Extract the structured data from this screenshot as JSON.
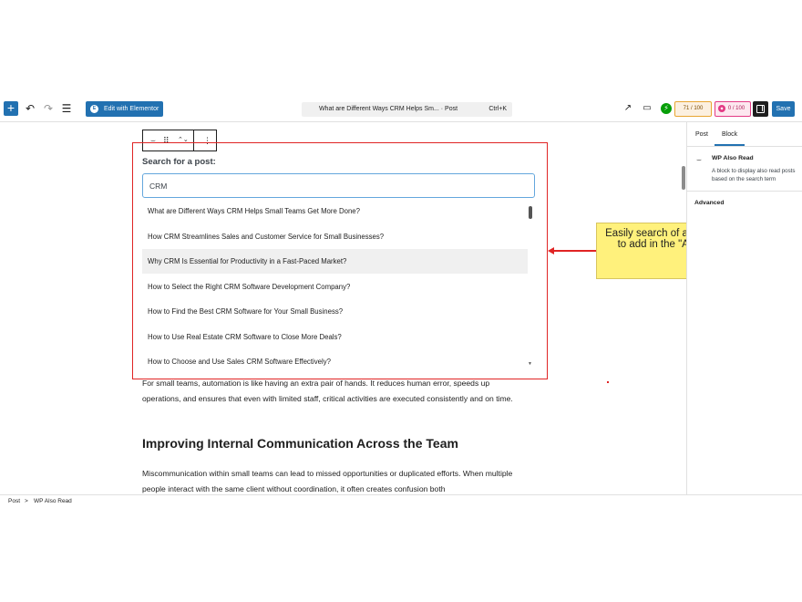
{
  "toolbar": {
    "add_icon": "plus-icon",
    "undo_icon": "undo-icon",
    "redo_icon": "redo-icon",
    "outline_icon": "list-view-icon",
    "edit_with_elementor": "Edit with Elementor",
    "command_title": "What are Different Ways CRM Helps Sm... · Post",
    "command_shortcut": "Ctrl+K",
    "score_seo": "71 / 100",
    "score_readability": "0 / 100",
    "save_label": "Save"
  },
  "block_editor": {
    "search_label": "Search for a post:",
    "search_value": "CRM",
    "results": [
      "What are Different Ways CRM Helps Small Teams Get More Done?",
      "How CRM Streamlines Sales and Customer Service for Small Businesses?",
      "Why CRM Is Essential for Productivity in a Fast-Paced Market?",
      "How to Select the Right CRM Software Development Company?",
      "How to Find the Best CRM Software for Your Small Business?",
      "How to Use Real Estate CRM Software to Close More Deals?",
      "How to Choose and Use Sales CRM Software Effectively?"
    ],
    "active_result_index": 2
  },
  "callout": {
    "text": "Easily search of a relevant blog post to add in the \"Also Read\" block"
  },
  "content": {
    "para1": "For small teams, automation is like having an extra pair of hands. It reduces human error, speeds up operations, and ensures that even with limited staff, critical activities are executed consistently and on time.",
    "heading": "Improving Internal Communication Across the Team",
    "para2": "Miscommunication within small teams can lead to missed opportunities or duplicated efforts. When multiple people interact with the same client without coordination, it often creates confusion both"
  },
  "sidebar": {
    "tab_post": "Post",
    "tab_block": "Block",
    "block_title": "WP Also Read",
    "block_desc_line1": "A block to display also read posts",
    "block_desc_line2": "based on the search term",
    "advanced": "Advanced"
  },
  "footer": {
    "crumb_post": "Post",
    "separator": ">",
    "crumb_block": "WP Also Read"
  },
  "colors": {
    "accent": "#2271b1",
    "highlight_border": "#e02424",
    "callout_bg": "#fff17c"
  }
}
